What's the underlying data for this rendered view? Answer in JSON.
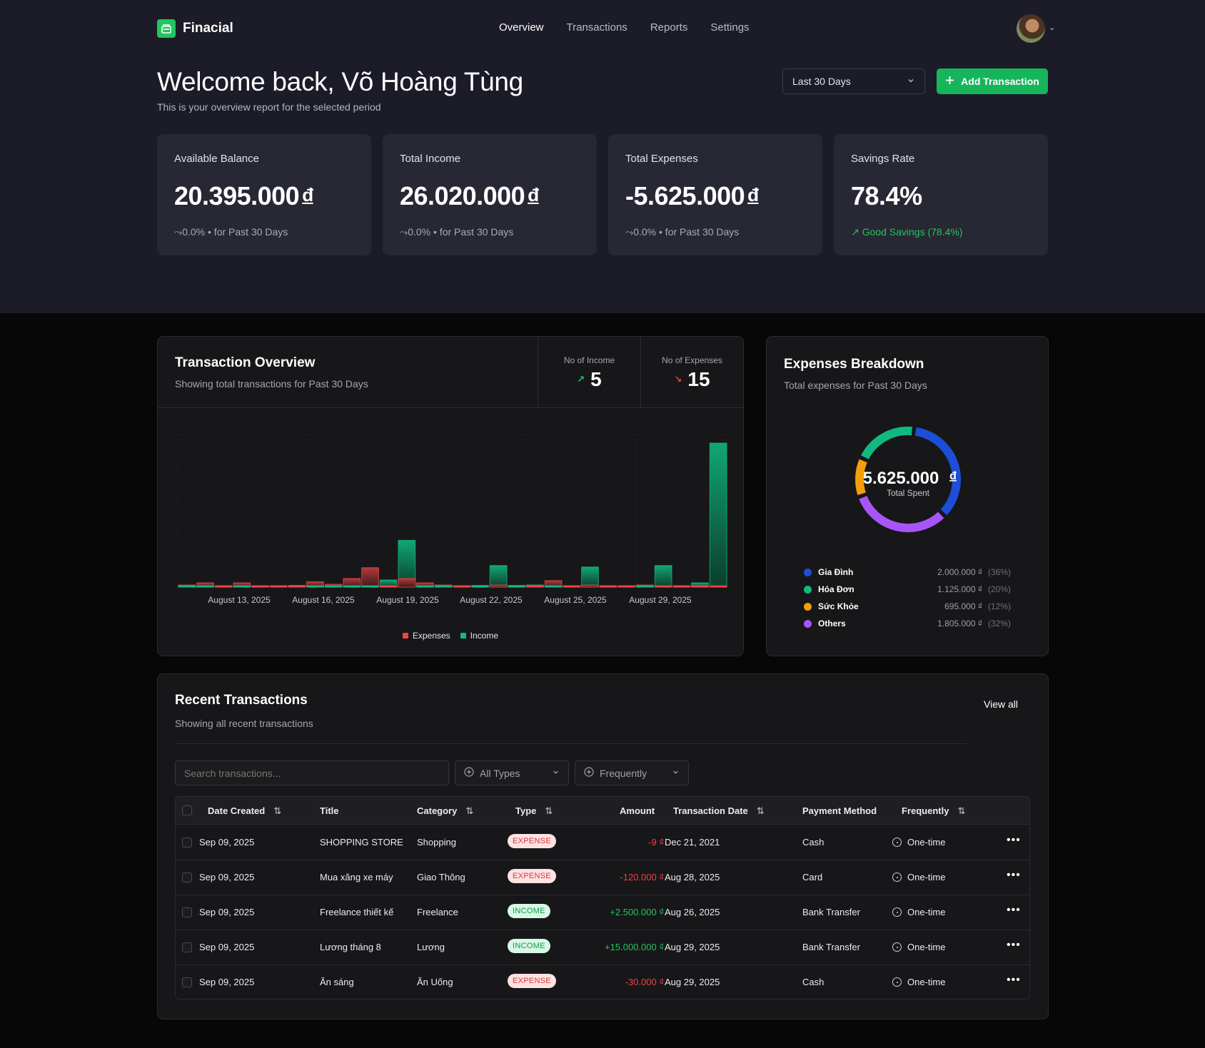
{
  "brand": {
    "name": "Finacial",
    "accent": "#16b55c"
  },
  "nav": {
    "items": [
      "Overview",
      "Transactions",
      "Reports",
      "Settings"
    ],
    "active": "Overview"
  },
  "header": {
    "title": "Welcome back, Võ Hoàng Tùng",
    "subtitle": "This is your overview report for the selected period",
    "period": "Last 30 Days",
    "add_label": "Add Transaction"
  },
  "stats": [
    {
      "label": "Available Balance",
      "value": "20.395.000",
      "currency": "đ",
      "trend": "0.0%",
      "period": "• for Past 30 Days"
    },
    {
      "label": "Total Income",
      "value": "26.020.000",
      "currency": "đ",
      "trend": "0.0%",
      "period": "• for Past 30 Days"
    },
    {
      "label": "Total Expenses",
      "value": "-5.625.000",
      "currency": "đ",
      "trend": "0.0%",
      "period": "• for Past 30 Days"
    },
    {
      "label": "Savings Rate",
      "value": "78.4%",
      "currency": "",
      "note": "Good Savings (78.4%)"
    }
  ],
  "overview": {
    "title": "Transaction Overview",
    "subtitle": "Showing total transactions for Past 30 Days",
    "income_count_label": "No of Income",
    "income_count": "5",
    "expense_count_label": "No of Expenses",
    "expense_count": "15",
    "legend_expenses": "Expenses",
    "legend_income": "Income"
  },
  "chart_data": {
    "type": "bar",
    "x_tick_labels": [
      "August 13, 2025",
      "August 16, 2025",
      "August 19, 2025",
      "August 22, 2025",
      "August 25, 2025",
      "August 29, 2025"
    ],
    "series": [
      {
        "name": "Expenses",
        "color": "#ef4444",
        "values": [
          30000,
          60000,
          0,
          60000,
          0,
          0,
          0,
          75000,
          40000,
          120000,
          270000,
          0,
          120000,
          60000,
          30000,
          0,
          25000,
          30000,
          25000,
          0,
          90000,
          0,
          30000,
          0,
          0,
          30000,
          0,
          0,
          0,
          0
        ]
      },
      {
        "name": "Income",
        "color": "#10b981",
        "values": [
          0,
          0,
          20000,
          0,
          0,
          15000,
          25000,
          0,
          0,
          0,
          0,
          100000,
          650000,
          0,
          0,
          0,
          0,
          300000,
          0,
          30000,
          0,
          0,
          280000,
          0,
          15000,
          0,
          300000,
          0,
          60000,
          2000000
        ]
      }
    ],
    "ylim": [
      0,
      2120000
    ],
    "grid": true,
    "legend": "bottom-center"
  },
  "breakdown": {
    "title": "Expenses Breakdown",
    "subtitle": "Total expenses for Past 30 Days",
    "total": "5.625.000",
    "currency": "đ",
    "total_label": "Total Spent",
    "items": [
      {
        "name": "Gia Đình",
        "amount": "2.000.000 ₫",
        "pct": "(36%)",
        "value": 2000000,
        "color": "#1d4ed8"
      },
      {
        "name": "Hóa Đơn",
        "amount": "1.125.000 ₫",
        "pct": "(20%)",
        "value": 1125000,
        "color": "#10b981"
      },
      {
        "name": "Sức Khỏe",
        "amount": "695.000 ₫",
        "pct": "(12%)",
        "value": 695000,
        "color": "#f59e0b"
      },
      {
        "name": "Others",
        "amount": "1.805.000 ₫",
        "pct": "(32%)",
        "value": 1805000,
        "color": "#a855f7"
      }
    ]
  },
  "recent": {
    "title": "Recent Transactions",
    "subtitle": "Showing all recent transactions",
    "view_all": "View all",
    "search_placeholder": "Search transactions...",
    "type_filter": "All Types",
    "freq_filter": "Frequently",
    "columns": [
      "Date Created",
      "Title",
      "Category",
      "Type",
      "Amount",
      "Transaction Date",
      "Payment Method",
      "Frequently"
    ],
    "rows": [
      {
        "date": "Sep 09, 2025",
        "title": "SHOPPING STORE",
        "category": "Shopping",
        "type": "EXPENSE",
        "amount": "-9 ₫",
        "tdate": "Dec 21, 2021",
        "method": "Cash",
        "freq": "One-time"
      },
      {
        "date": "Sep 09, 2025",
        "title": "Mua xăng xe máy",
        "category": "Giao Thông",
        "type": "EXPENSE",
        "amount": "-120.000 ₫",
        "tdate": "Aug 28, 2025",
        "method": "Card",
        "freq": "One-time"
      },
      {
        "date": "Sep 09, 2025",
        "title": "Freelance thiết kế",
        "category": "Freelance",
        "type": "INCOME",
        "amount": "+2.500.000 ₫",
        "tdate": "Aug 26, 2025",
        "method": "Bank Transfer",
        "freq": "One-time"
      },
      {
        "date": "Sep 09, 2025",
        "title": "Lương tháng 8",
        "category": "Lương",
        "type": "INCOME",
        "amount": "+15.000.000 ₫",
        "tdate": "Aug 29, 2025",
        "method": "Bank Transfer",
        "freq": "One-time"
      },
      {
        "date": "Sep 09, 2025",
        "title": "Ăn sáng",
        "category": "Ăn Uống",
        "type": "EXPENSE",
        "amount": "-30.000 ₫",
        "tdate": "Aug 29, 2025",
        "method": "Cash",
        "freq": "One-time"
      }
    ]
  }
}
